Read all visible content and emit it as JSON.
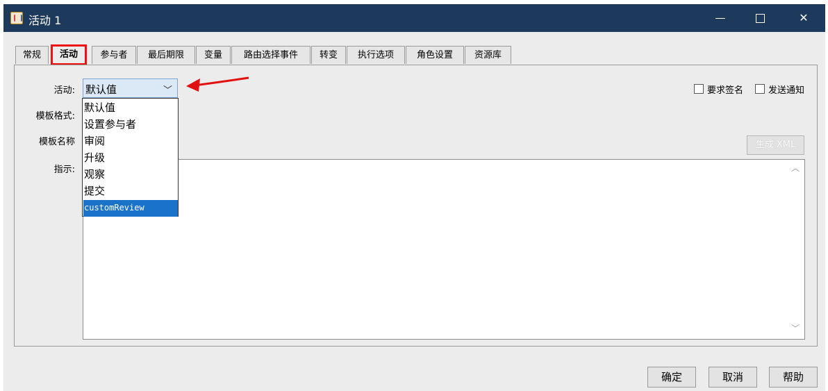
{
  "window": {
    "title": "活动 1",
    "icon": "java-app-icon",
    "controls": {
      "minimize": "minimize-icon",
      "maximize": "maximize-icon",
      "close": "✕"
    }
  },
  "tabs": [
    {
      "label": "常规",
      "active": false
    },
    {
      "label": "活动",
      "active": true
    },
    {
      "label": "参与者",
      "active": false
    },
    {
      "label": "最后期限",
      "active": false
    },
    {
      "label": "变量",
      "active": false
    },
    {
      "label": "路由选择事件",
      "active": false
    },
    {
      "label": "转变",
      "active": false
    },
    {
      "label": "执行选项",
      "active": false
    },
    {
      "label": "角色设置",
      "active": false
    },
    {
      "label": "资源库",
      "active": false
    }
  ],
  "form": {
    "activity_label": "活动:",
    "activity_value": "默认值",
    "template_format_label": "模板格式:",
    "template_name_label": "模板名称",
    "instructions_label": "指示:",
    "generate_xml_label": "生成 XML"
  },
  "dropdown": {
    "options": [
      "默认值",
      "设置参与者",
      "审阅",
      "升级",
      "观察",
      "提交",
      "customReview"
    ],
    "highlighted": "customReview"
  },
  "checkboxes": [
    {
      "label": "要求签名",
      "checked": false
    },
    {
      "label": "发送通知",
      "checked": false
    }
  ],
  "footer": {
    "ok_label": "确定",
    "cancel_label": "取消",
    "help_label": "帮助"
  },
  "annotation": {
    "highlight_color": "#e11111",
    "arrow_color": "#e11111"
  }
}
